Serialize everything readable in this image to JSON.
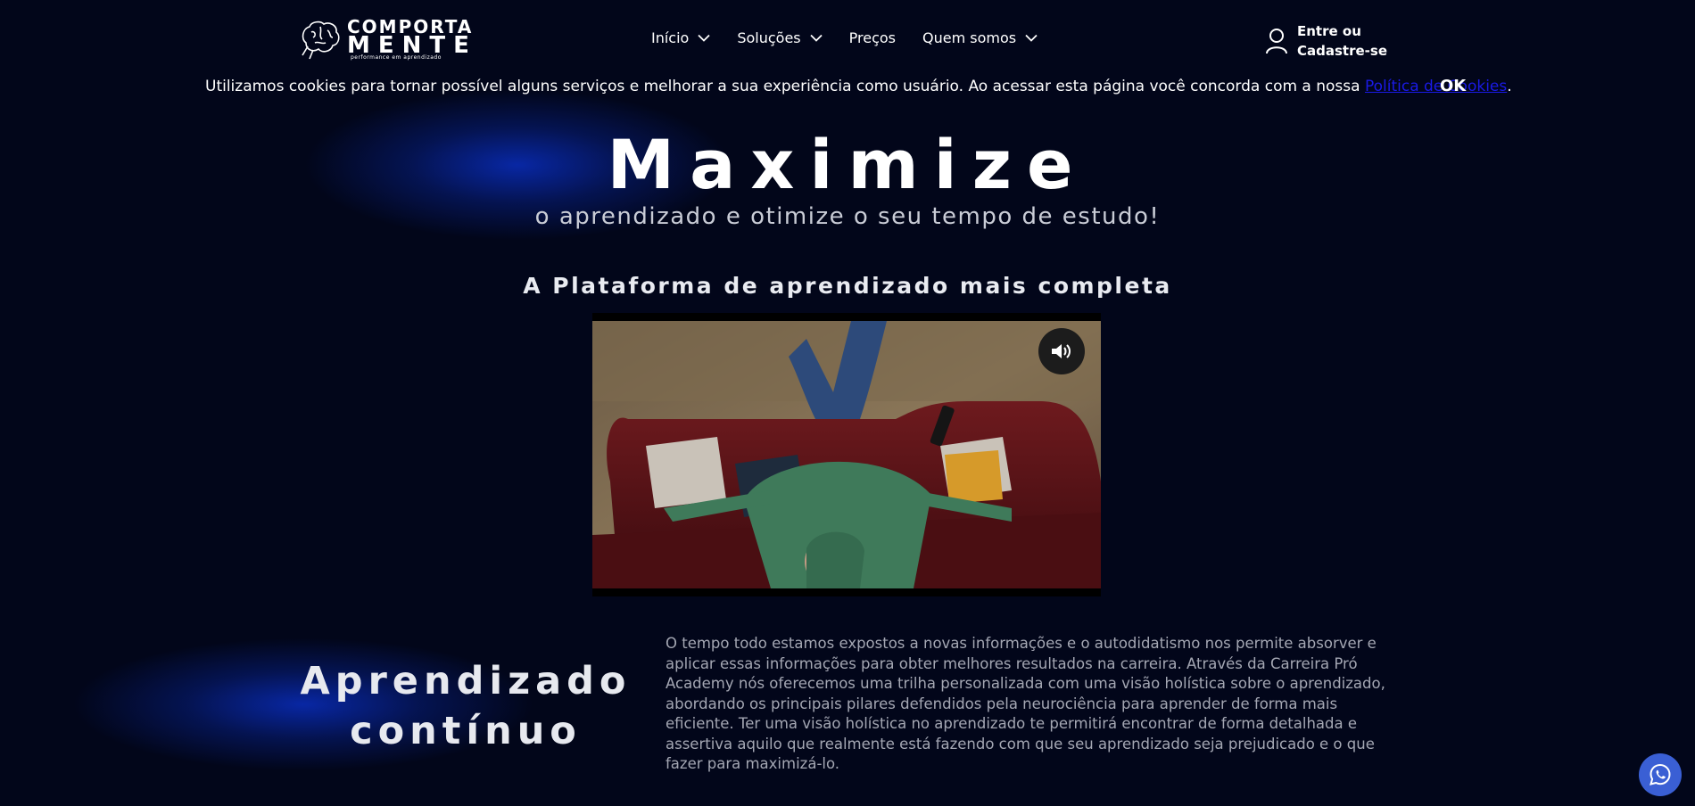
{
  "header": {
    "logo": {
      "line1": "COMPORTA",
      "line2": "MENTE",
      "tagline": "performance em aprendizado"
    },
    "nav": [
      {
        "label": "Início",
        "has_dropdown": true
      },
      {
        "label": "Soluções",
        "has_dropdown": true
      },
      {
        "label": "Preços",
        "has_dropdown": false
      },
      {
        "label": "Quem somos",
        "has_dropdown": true
      }
    ],
    "account": {
      "line1": "Entre ou",
      "line2": "Cadastre-se",
      "icon": "user-icon"
    }
  },
  "cookie_banner": {
    "text": "Utilizamos cookies para tornar possível alguns serviços e melhorar a sua experiência como usuário. Ao acessar esta página você concorda com a nossa ",
    "link_text": "Política de Cookies",
    "suffix": ".",
    "ok_label": "OK"
  },
  "hero": {
    "title": "Maximize",
    "subtitle": "o aprendizado e otimize o seu tempo de estudo!",
    "section_title": "A Plataforma de aprendizado mais completa"
  },
  "video": {
    "sound_icon": "volume-icon"
  },
  "learning": {
    "title_line1": "Aprendizado",
    "title_line2": "contínuo",
    "body": "O tempo todo estamos expostos a novas informações e o autodidatismo nos permite absorver e aplicar essas informações para obter melhores resultados na carreira. Através da Carreira Pró Academy nós oferecemos uma trilha personalizada com uma visão holística sobre o aprendizado, abordando os principais pilares defendidos pela neurociência para aprender de forma mais eficiente. Ter uma visão holística no aprendizado te permitirá encontrar de forma detalhada e assertiva aquilo que realmente está fazendo com que seu aprendizado seja prejudicado e o que fazer para maximizá-lo."
  },
  "floating": {
    "whatsapp_icon": "whatsapp-icon"
  },
  "colors": {
    "background": "#02061a",
    "glow": "#0a32d2",
    "link": "#1a1ae6",
    "whatsapp": "#3a5fd4"
  }
}
